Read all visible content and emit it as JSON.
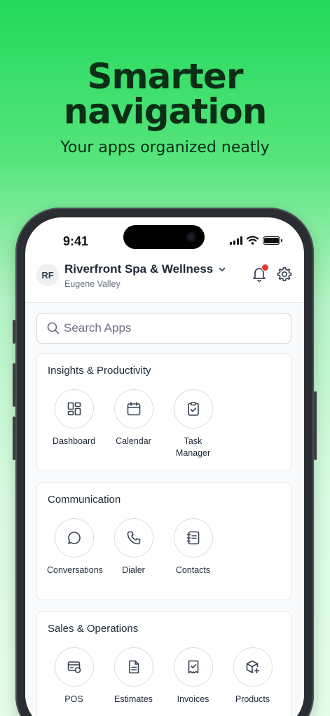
{
  "hero": {
    "title_line1": "Smarter",
    "title_line2": "navigation",
    "subtitle": "Your apps organized neatly"
  },
  "status_bar": {
    "time": "9:41"
  },
  "header": {
    "avatar_initials": "RF",
    "business_name": "Riverfront Spa & Wellness",
    "location": "Eugene Valley"
  },
  "search": {
    "placeholder": "Search Apps",
    "value": ""
  },
  "sections": [
    {
      "title": "Insights & Productivity",
      "apps": [
        {
          "label": "Dashboard",
          "icon": "dashboard-icon"
        },
        {
          "label": "Calendar",
          "icon": "calendar-icon"
        },
        {
          "label": "Task Manager",
          "icon": "clipboard-check-icon"
        }
      ]
    },
    {
      "title": "Communication",
      "apps": [
        {
          "label": "Conversations",
          "icon": "chat-bubble-icon"
        },
        {
          "label": "Dialer",
          "icon": "phone-icon"
        },
        {
          "label": "Contacts",
          "icon": "address-book-icon"
        }
      ]
    },
    {
      "title": "Sales & Operations",
      "apps": [
        {
          "label": "POS",
          "icon": "pos-terminal-icon"
        },
        {
          "label": "Estimates",
          "icon": "document-icon"
        },
        {
          "label": "Invoices",
          "icon": "invoice-check-icon"
        },
        {
          "label": "Products",
          "icon": "box-plus-icon"
        }
      ]
    }
  ],
  "colors": {
    "brand_green": "#22d95a",
    "hero_text": "#0b2e17",
    "notification_dot": "#e53935",
    "icon_stroke": "#374151"
  }
}
